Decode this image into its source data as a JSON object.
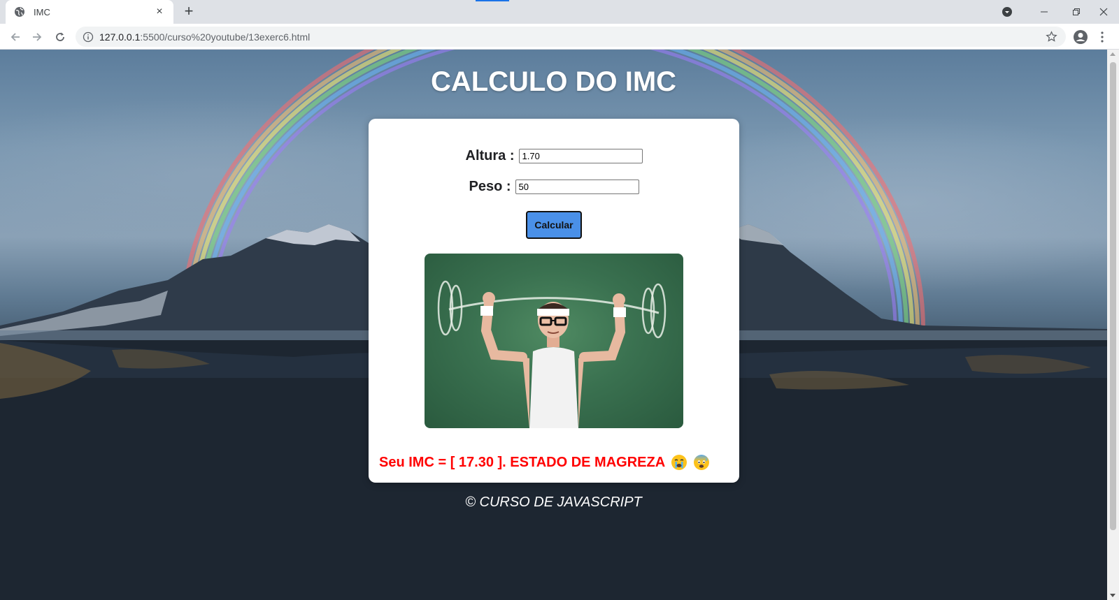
{
  "browser": {
    "tab_title": "IMC",
    "new_tab_symbol": "+",
    "tab_close_symbol": "×",
    "url_host": "127.0.0.1",
    "url_path": ":5500/curso%20youtube/13exerc6.html"
  },
  "page": {
    "title": "CALCULO DO IMC",
    "form": {
      "altura_label": "Altura :",
      "altura_value": "1.70",
      "peso_label": "Peso :",
      "peso_value": "50",
      "button_label": "Calcular"
    },
    "result_text": "Seu IMC = [ 17.30 ]. ESTADO DE MAGREZA",
    "footer": "© CURSO DE JAVASCRIPT"
  },
  "icons": [
    "globe-icon",
    "close-icon",
    "plus-icon",
    "media-control-icon",
    "minimize-icon",
    "restore-icon",
    "window-close-icon",
    "back-arrow-icon",
    "forward-arrow-icon",
    "reload-icon",
    "info-icon",
    "star-icon",
    "profile-icon",
    "menu-kebab-icon",
    "crying-face-emoji",
    "fearful-face-emoji"
  ],
  "colors": {
    "button_bg": "#4a90e8",
    "result_text": "#ff0000",
    "title_text": "#ffffff",
    "card_bg": "#ffffff"
  }
}
